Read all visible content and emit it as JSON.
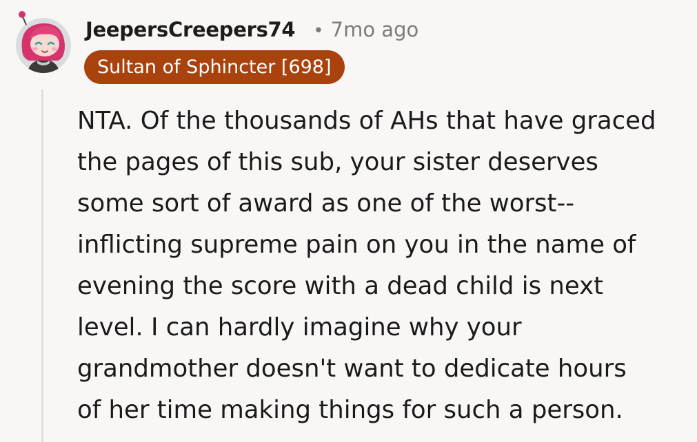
{
  "comment": {
    "author": "JeepersCreepers74",
    "separator": "•",
    "time_ago": "7mo ago",
    "flair": "Sultan of Sphincter [698]",
    "avatar_icon": "snoo-avatar-icon",
    "flair_color": "#a9420c",
    "body_lines": [
      "NTA. Of the thousands of AHs that have graced",
      "the pages of this sub, your sister deserves",
      "some sort of award as one of the worst--",
      "inflicting supreme pain on you in the name of",
      "evening the score with a dead child is next",
      "level. I can hardly imagine why your",
      "grandmother doesn't want to dedicate hours",
      "of her time making things for such a person."
    ]
  }
}
